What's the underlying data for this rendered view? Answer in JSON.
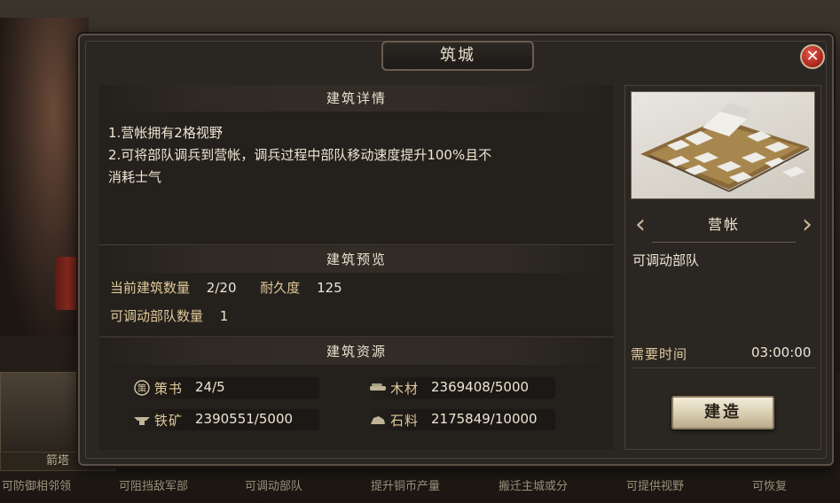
{
  "background": {
    "cards": [
      {
        "label": "箭塔",
        "desc": "可防御相邻领"
      },
      {
        "label": "",
        "desc": "可阻挡敌军部"
      },
      {
        "label": "",
        "desc": "可调动部队"
      },
      {
        "label": "",
        "desc": "提升铜币产量"
      },
      {
        "label": "",
        "desc": "搬迁主城或分"
      },
      {
        "label": "",
        "desc": "可提供视野"
      },
      {
        "label": "",
        "desc": "可恢复"
      }
    ]
  },
  "dialog": {
    "title": "筑城",
    "close_icon": "close-icon"
  },
  "details": {
    "header": "建筑详情",
    "line1": "1.营帐拥有2格视野",
    "line2": "2.可将部队调兵到营帐，调兵过程中部队移动速度提升100%且不",
    "line3": "消耗士气"
  },
  "preview": {
    "header": "建筑预览",
    "count_label": "当前建筑数量",
    "count_value": "2/20",
    "durability_label": "耐久度",
    "durability_value": "125",
    "troops_label": "可调动部队数量",
    "troops_value": "1"
  },
  "resources": {
    "header": "建筑资源",
    "items": [
      {
        "icon": "book-icon",
        "label": "策书",
        "value": "24/5"
      },
      {
        "icon": "wood-icon",
        "label": "木材",
        "value": "2369408/5000"
      },
      {
        "icon": "iron-icon",
        "label": "铁矿",
        "value": "2390551/5000"
      },
      {
        "icon": "stone-icon",
        "label": "石料",
        "value": "2175849/10000"
      }
    ]
  },
  "building": {
    "name": "营帐",
    "description": "可调动部队",
    "time_label": "需要时间",
    "time_value": "03:00:00",
    "build_label": "建造"
  }
}
